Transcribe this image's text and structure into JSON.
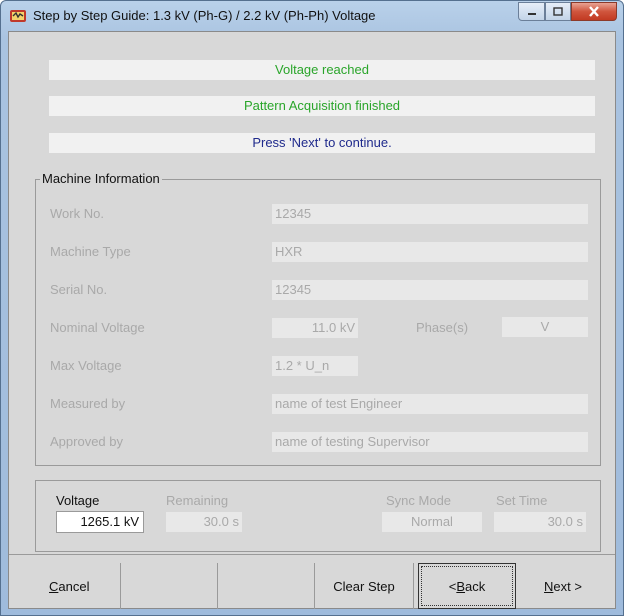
{
  "window": {
    "title": "Step by Step Guide: 1.3 kV (Ph-G) / 2.2 kV (Ph-Ph) Voltage"
  },
  "status": {
    "line1": "Voltage reached",
    "line2": "Pattern Acquisition finished",
    "line3": "Press 'Next' to continue."
  },
  "machine": {
    "legend": "Machine Information",
    "work_no_label": "Work No.",
    "work_no": "12345",
    "machine_type_label": "Machine Type",
    "machine_type": "HXR",
    "serial_no_label": "Serial No.",
    "serial_no": "12345",
    "nominal_voltage_label": "Nominal Voltage",
    "nominal_voltage": "11.0 kV",
    "phases_label": "Phase(s)",
    "phases": "V",
    "max_voltage_label": "Max Voltage",
    "max_voltage": "1.2 * U_n",
    "measured_by_label": "Measured by",
    "measured_by": "name of test Engineer",
    "approved_by_label": "Approved by",
    "approved_by": "name of testing Supervisor"
  },
  "measurement": {
    "voltage_label": "Voltage",
    "voltage": "1265.1 kV",
    "remaining_label": "Remaining",
    "remaining": "30.0  s",
    "sync_mode_label": "Sync Mode",
    "sync_mode": "Normal",
    "set_time_label": "Set Time",
    "set_time": "30.0  s"
  },
  "buttons": {
    "cancel_mnemonic": "C",
    "cancel_rest": "ancel",
    "clear_step": "Clear Step",
    "back_prefix": "< ",
    "back_mnemonic": "B",
    "back_rest": "ack",
    "next_mnemonic": "N",
    "next_rest": "ext >"
  },
  "colors": {
    "status_green": "#2aa52a",
    "status_blue": "#1f2a8c",
    "close_button": "#c23a22"
  }
}
